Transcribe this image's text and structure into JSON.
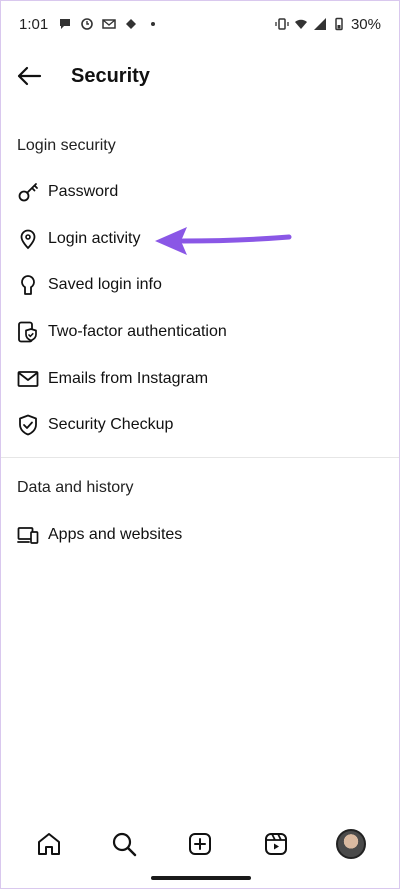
{
  "status_bar": {
    "time": "1:01",
    "battery": "30%"
  },
  "header": {
    "title": "Security"
  },
  "sections": {
    "login_security": {
      "title": "Login security",
      "items": [
        {
          "label": "Password",
          "icon": "key-icon"
        },
        {
          "label": "Login activity",
          "icon": "location-pin-icon"
        },
        {
          "label": "Saved login info",
          "icon": "keyhole-icon"
        },
        {
          "label": "Two-factor authentication",
          "icon": "shield-phone-icon"
        },
        {
          "label": "Emails from Instagram",
          "icon": "envelope-icon"
        },
        {
          "label": "Security Checkup",
          "icon": "shield-check-icon"
        }
      ]
    },
    "data_history": {
      "title": "Data and history",
      "items": [
        {
          "label": "Apps and websites",
          "icon": "devices-icon"
        }
      ]
    }
  },
  "bottom_nav": [
    {
      "name": "home",
      "icon": "home-icon"
    },
    {
      "name": "search",
      "icon": "search-icon"
    },
    {
      "name": "create",
      "icon": "plus-square-icon"
    },
    {
      "name": "reels",
      "icon": "reels-icon"
    },
    {
      "name": "profile",
      "icon": "avatar"
    }
  ],
  "colors": {
    "annotation_arrow": "#8a57e6",
    "text": "#111111",
    "divider": "#e6e6e6"
  }
}
